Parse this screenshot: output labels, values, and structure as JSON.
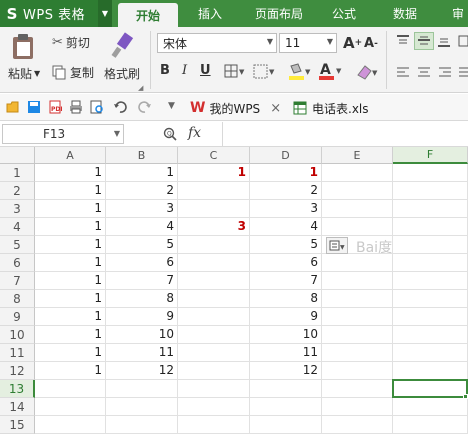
{
  "app": {
    "name": "WPS 表格",
    "logo": "S"
  },
  "menu": {
    "tabs": [
      "开始",
      "插入",
      "页面布局",
      "公式",
      "数据",
      "审"
    ],
    "active": "开始"
  },
  "ribbon": {
    "paste": "粘贴",
    "cut": "剪切",
    "copy": "复制",
    "format_painter": "格式刷",
    "font_name": "宋体",
    "font_size": "11",
    "bold": "B",
    "italic": "I",
    "underline": "U"
  },
  "quickbar": {
    "doc_tabs": [
      {
        "label": "我的WPS",
        "icon": "wps-logo-icon",
        "closable": true
      },
      {
        "label": "电话表.xls",
        "icon": "spreadsheet-icon",
        "closable": false
      }
    ]
  },
  "formula_bar": {
    "cell_ref": "F13",
    "fx": "fx",
    "value": ""
  },
  "sheet": {
    "columns": [
      "A",
      "B",
      "C",
      "D",
      "E",
      "F"
    ],
    "selected_column": "F",
    "selected_row": "13",
    "rows": [
      {
        "num": "1",
        "cells": [
          "1",
          "1",
          "1",
          "1",
          "",
          ""
        ]
      },
      {
        "num": "2",
        "cells": [
          "1",
          "2",
          "",
          "2",
          "",
          ""
        ]
      },
      {
        "num": "3",
        "cells": [
          "1",
          "3",
          "",
          "3",
          "",
          ""
        ]
      },
      {
        "num": "4",
        "cells": [
          "1",
          "4",
          "3",
          "4",
          "",
          ""
        ]
      },
      {
        "num": "5",
        "cells": [
          "1",
          "5",
          "",
          "5",
          "",
          ""
        ]
      },
      {
        "num": "6",
        "cells": [
          "1",
          "6",
          "",
          "6",
          "",
          ""
        ]
      },
      {
        "num": "7",
        "cells": [
          "1",
          "7",
          "",
          "7",
          "",
          ""
        ]
      },
      {
        "num": "8",
        "cells": [
          "1",
          "8",
          "",
          "8",
          "",
          ""
        ]
      },
      {
        "num": "9",
        "cells": [
          "1",
          "9",
          "",
          "9",
          "",
          ""
        ]
      },
      {
        "num": "10",
        "cells": [
          "1",
          "10",
          "",
          "10",
          "",
          ""
        ]
      },
      {
        "num": "11",
        "cells": [
          "1",
          "11",
          "",
          "11",
          "",
          ""
        ]
      },
      {
        "num": "12",
        "cells": [
          "1",
          "12",
          "",
          "12",
          "",
          ""
        ]
      },
      {
        "num": "13",
        "cells": [
          "",
          "",
          "",
          "",
          "",
          ""
        ]
      },
      {
        "num": "14",
        "cells": [
          "",
          "",
          "",
          "",
          "",
          ""
        ]
      },
      {
        "num": "15",
        "cells": [
          "",
          "",
          "",
          "",
          "",
          ""
        ]
      }
    ],
    "red_cells": [
      "C1",
      "D1",
      "C4"
    ]
  },
  "colors": {
    "accent": "#3f8d3f",
    "selection": "#3c8b3c",
    "red_text": "#c00000"
  },
  "watermark": "Bai度"
}
